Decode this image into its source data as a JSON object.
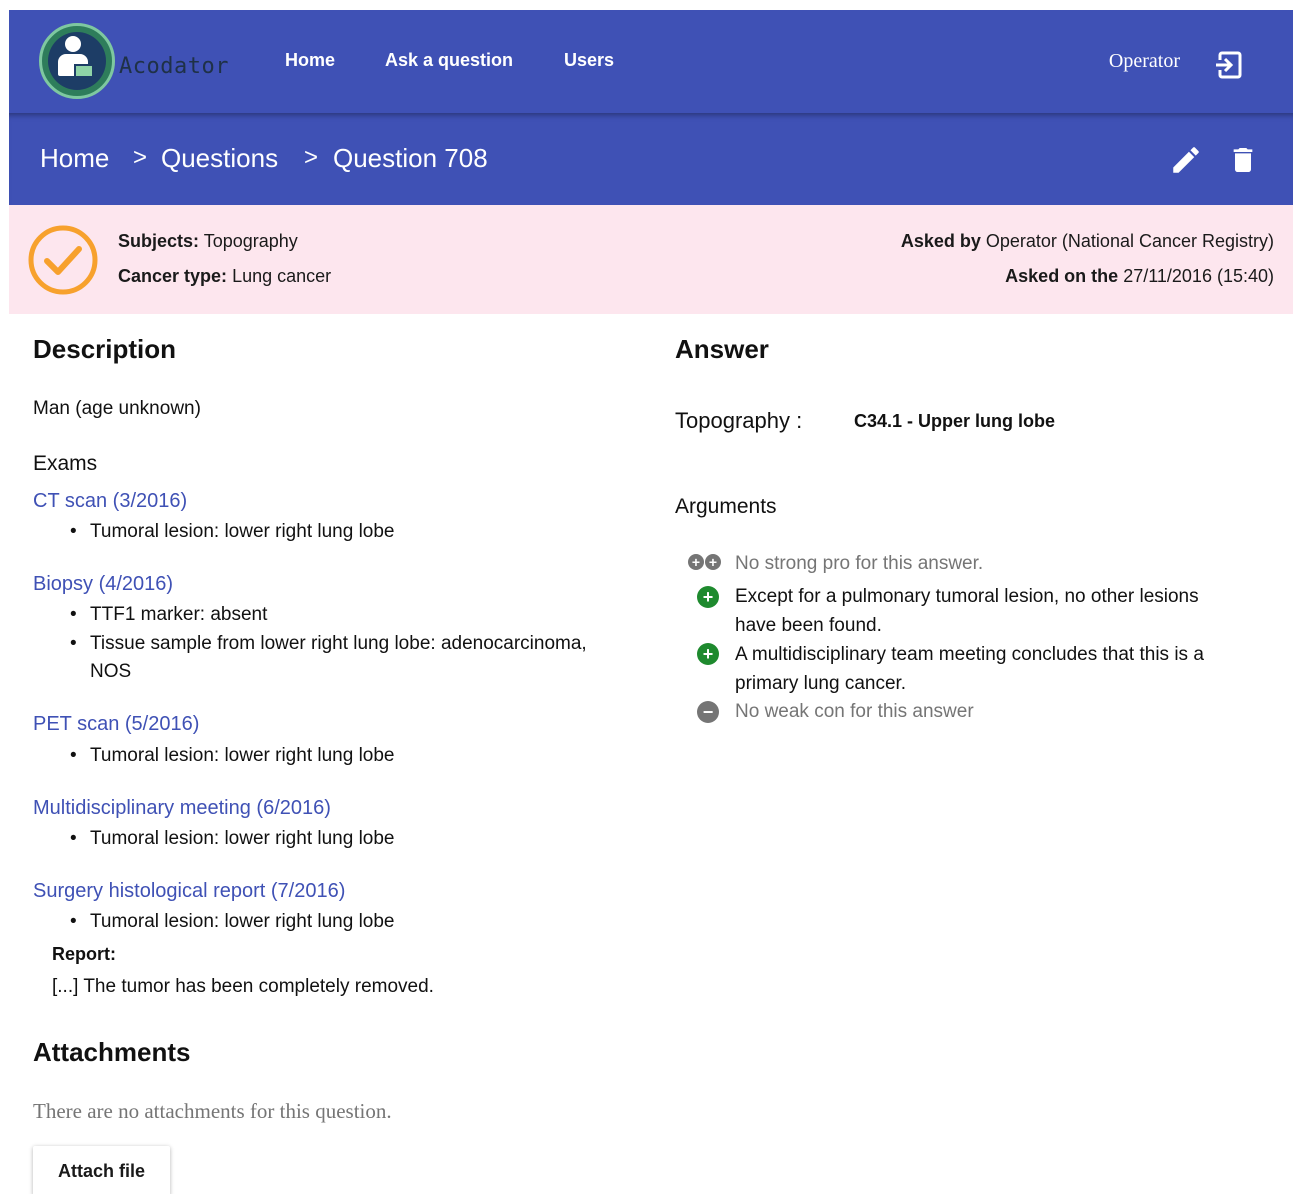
{
  "nav": {
    "logo_text": "Acodator",
    "home": "Home",
    "ask": "Ask a question",
    "users": "Users",
    "user": "Operator"
  },
  "breadcrumb": {
    "home": "Home",
    "sep": ">",
    "questions": "Questions",
    "current": "Question 708"
  },
  "info": {
    "subjects_label": "Subjects:",
    "subjects_value": "Topography",
    "cancer_label": "Cancer type:",
    "cancer_value": "Lung cancer",
    "asked_by_label": "Asked by",
    "asked_by_value": "Operator (National Cancer Registry)",
    "asked_on_label": "Asked on the",
    "asked_on_value": "27/11/2016 (15:40)"
  },
  "description": {
    "title": "Description",
    "patient": "Man (age unknown)",
    "exams_title": "Exams",
    "exams": [
      {
        "name": "CT scan (3/2016)",
        "items": [
          "Tumoral lesion: lower right lung lobe"
        ]
      },
      {
        "name": "Biopsy (4/2016)",
        "items": [
          "TTF1 marker: absent",
          "Tissue sample from lower right lung lobe: adenocarcinoma, NOS"
        ]
      },
      {
        "name": "PET scan (5/2016)",
        "items": [
          "Tumoral lesion: lower right lung lobe"
        ]
      },
      {
        "name": "Multidisciplinary meeting (6/2016)",
        "items": [
          "Tumoral lesion: lower right lung lobe"
        ]
      },
      {
        "name": "Surgery histological report (7/2016)",
        "items": [
          "Tumoral lesion: lower right lung lobe"
        ],
        "report_label": "Report:",
        "report_text": "[...] The tumor has been completely removed."
      }
    ]
  },
  "attachments": {
    "title": "Attachments",
    "empty": "There are no attachments for this question.",
    "button": "Attach file"
  },
  "answer": {
    "title": "Answer",
    "field_label": "Topography :",
    "field_value": "C34.1 - Upper lung lobe",
    "arguments_title": "Arguments",
    "arguments": [
      {
        "type": "strong-pro",
        "text": "No strong pro for this answer."
      },
      {
        "type": "pro",
        "text": "Except for a pulmonary tumoral lesion, no other lesions have been found."
      },
      {
        "type": "pro",
        "text": "A multidisciplinary team meeting concludes that this is a primary lung cancer."
      },
      {
        "type": "weak-con",
        "text": "No weak con for this answer"
      }
    ]
  },
  "colors": {
    "primary": "#3f51b5",
    "info_bg": "#fde6ee",
    "status": "#f7a12d",
    "pro": "#1e8a2e",
    "muted": "#757575"
  },
  "icons": [
    "logout-icon",
    "edit-icon",
    "delete-icon",
    "check-circle-icon",
    "plus-icon",
    "minus-icon"
  ]
}
